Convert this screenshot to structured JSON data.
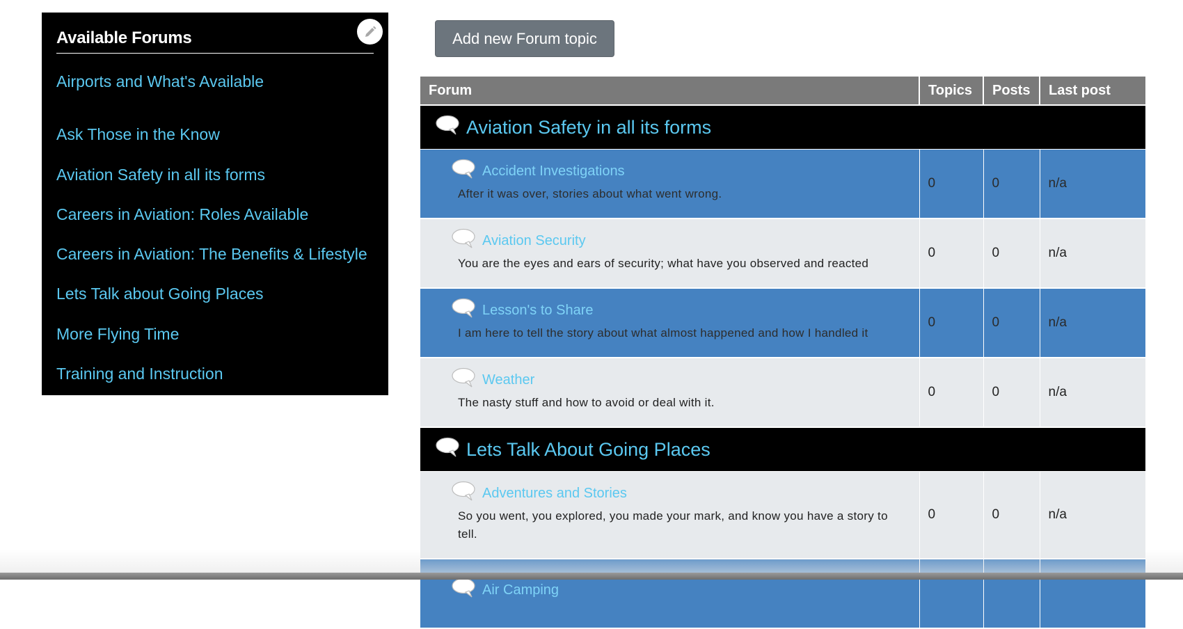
{
  "sidebar": {
    "title": "Available Forums",
    "edit_icon": "pencil-icon",
    "items": [
      {
        "label": "Airports and What's Available"
      },
      {
        "label": "Ask Those in the Know"
      },
      {
        "label": "Aviation Safety in all its forms"
      },
      {
        "label": "Careers in Aviation: Roles Available"
      },
      {
        "label": "Careers in Aviation: The Benefits & Lifestyle"
      },
      {
        "label": "Lets Talk about Going Places"
      },
      {
        "label": "More Flying Time"
      },
      {
        "label": "Training and Instruction"
      }
    ]
  },
  "toolbar": {
    "add_label": "Add new Forum topic"
  },
  "table": {
    "headers": {
      "forum": "Forum",
      "topics": "Topics",
      "posts": "Posts",
      "last_post": "Last post"
    },
    "categories": [
      {
        "title": "Aviation Safety in all its forms",
        "forums": [
          {
            "name": "Accident Investigations",
            "description": "After it was over, stories about what went wrong.",
            "topics": "0",
            "posts": "0",
            "last_post": "n/a"
          },
          {
            "name": "Aviation Security",
            "description": "You are the eyes and ears of security; what have you observed and reacted",
            "topics": "0",
            "posts": "0",
            "last_post": "n/a"
          },
          {
            "name": "Lesson's to Share",
            "description": "I am here to tell the story about what almost happened and how I handled it",
            "topics": "0",
            "posts": "0",
            "last_post": "n/a"
          },
          {
            "name": "Weather",
            "description": "The nasty stuff and how to avoid or deal with it.",
            "topics": "0",
            "posts": "0",
            "last_post": "n/a"
          }
        ]
      },
      {
        "title": "Lets Talk About Going Places",
        "forums": [
          {
            "name": "Adventures and Stories",
            "description": "So you went, you explored, you made your mark, and know you have a story to tell.",
            "topics": "0",
            "posts": "0",
            "last_post": "n/a"
          },
          {
            "name": "Air Camping",
            "description": "",
            "topics": "",
            "posts": "",
            "last_post": ""
          }
        ]
      }
    ]
  },
  "colors": {
    "link": "#5bc8f0",
    "row_blue": "#4582c1",
    "row_grey": "#e7eaed",
    "header": "#7a7a7a",
    "button": "#6c757d"
  },
  "icons": {
    "forum": "speech-bubble-icon"
  }
}
